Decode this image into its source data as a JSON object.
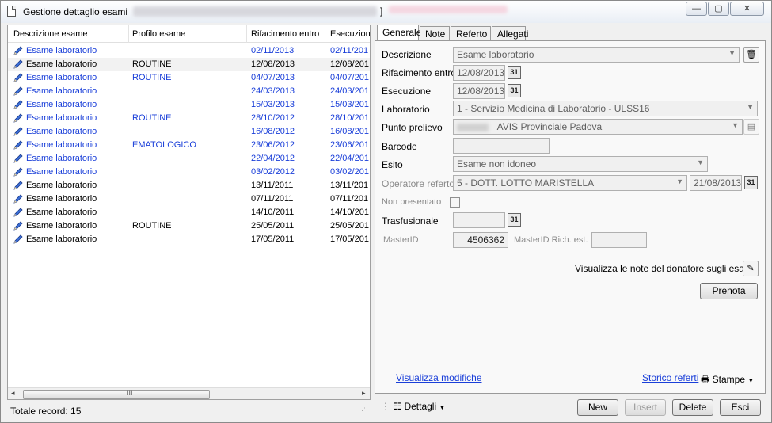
{
  "window": {
    "title": "Gestione dettaglio esami",
    "title_suffix": "]",
    "minimize_glyph": "—",
    "maximize_glyph": "▢",
    "close_glyph": "✕"
  },
  "list": {
    "columns": [
      "Descrizione esame",
      "Profilo esame",
      "Rifacimento entro",
      "Esecuzion"
    ],
    "rows": [
      {
        "desc": "Esame laboratorio",
        "profilo": "",
        "rifacimento": "02/11/2013",
        "esecuzione": "02/11/201",
        "blue": true
      },
      {
        "desc": "Esame laboratorio",
        "profilo": "ROUTINE",
        "rifacimento": "12/08/2013",
        "esecuzione": "12/08/201",
        "blue": false
      },
      {
        "desc": "Esame laboratorio",
        "profilo": "ROUTINE",
        "rifacimento": "04/07/2013",
        "esecuzione": "04/07/201",
        "blue": true
      },
      {
        "desc": "Esame laboratorio",
        "profilo": "",
        "rifacimento": "24/03/2013",
        "esecuzione": "24/03/201",
        "blue": true
      },
      {
        "desc": "Esame laboratorio",
        "profilo": "",
        "rifacimento": "15/03/2013",
        "esecuzione": "15/03/201",
        "blue": true
      },
      {
        "desc": "Esame laboratorio",
        "profilo": "ROUTINE",
        "rifacimento": "28/10/2012",
        "esecuzione": "28/10/201",
        "blue": true
      },
      {
        "desc": "Esame laboratorio",
        "profilo": "",
        "rifacimento": "16/08/2012",
        "esecuzione": "16/08/201",
        "blue": true
      },
      {
        "desc": "Esame laboratorio",
        "profilo": "EMATOLOGICO",
        "rifacimento": "23/06/2012",
        "esecuzione": "23/06/201",
        "blue": true
      },
      {
        "desc": "Esame laboratorio",
        "profilo": "",
        "rifacimento": "22/04/2012",
        "esecuzione": "22/04/201",
        "blue": true
      },
      {
        "desc": "Esame laboratorio",
        "profilo": "",
        "rifacimento": "03/02/2012",
        "esecuzione": "03/02/201",
        "blue": true
      },
      {
        "desc": "Esame laboratorio",
        "profilo": "",
        "rifacimento": "13/11/2011",
        "esecuzione": "13/11/201",
        "blue": false
      },
      {
        "desc": "Esame laboratorio",
        "profilo": "",
        "rifacimento": "07/11/2011",
        "esecuzione": "07/11/201",
        "blue": false
      },
      {
        "desc": "Esame laboratorio",
        "profilo": "",
        "rifacimento": "14/10/2011",
        "esecuzione": "14/10/201",
        "blue": false
      },
      {
        "desc": "Esame laboratorio",
        "profilo": "ROUTINE",
        "rifacimento": "25/05/2011",
        "esecuzione": "25/05/201",
        "blue": false
      },
      {
        "desc": "Esame laboratorio",
        "profilo": "",
        "rifacimento": "17/05/2011",
        "esecuzione": "17/05/201",
        "blue": false
      }
    ],
    "scroll_grip": "III",
    "scroll_left": "◂",
    "scroll_right": "▸",
    "footer": "Totale record: 15"
  },
  "tabs": [
    "Generale",
    "Note",
    "Referto",
    "Allegati"
  ],
  "form": {
    "descrizione_label": "Descrizione",
    "descrizione_value": "Esame laboratorio",
    "rifacimento_label": "Rifacimento entro",
    "rifacimento_value": "12/08/2013",
    "esecuzione_label": "Esecuzione",
    "esecuzione_value": "12/08/2013",
    "laboratorio_label": "Laboratorio",
    "laboratorio_value": "1 -  Servizio Medicina di Laboratorio - ULSS16",
    "punto_label": "Punto prelievo",
    "punto_value": "AVIS Provinciale Padova",
    "barcode_label": "Barcode",
    "barcode_value": "",
    "esito_label": "Esito",
    "esito_value": "Esame non idoneo",
    "operatore_label": "Operatore referto",
    "operatore_value": "5 -  DOTT. LOTTO MARISTELLA",
    "operatore_date": "21/08/2013",
    "non_presentato_label": "Non presentato",
    "trasfusionale_label": "Trasfusionale",
    "trasfusionale_value": "",
    "masterid_label": "MasterID",
    "masterid_value": "4506362",
    "masterid_rich_label": "MasterID Rich. est.",
    "masterid_rich_value": "",
    "calendar_glyph": "31",
    "dropdown_glyph": "▼"
  },
  "note_donatore": "Visualizza le note del donatore sugli esami",
  "prenota": "Prenota",
  "links": {
    "modifiche": "Visualizza modifiche",
    "storico": "Storico referti"
  },
  "stampe": "Stampe",
  "dettagli": "Dettagli",
  "buttons": {
    "new": "New",
    "insert": "Insert",
    "delete": "Delete",
    "exit": "Esci"
  },
  "colors": {
    "link_blue": "#1a3fd9"
  }
}
